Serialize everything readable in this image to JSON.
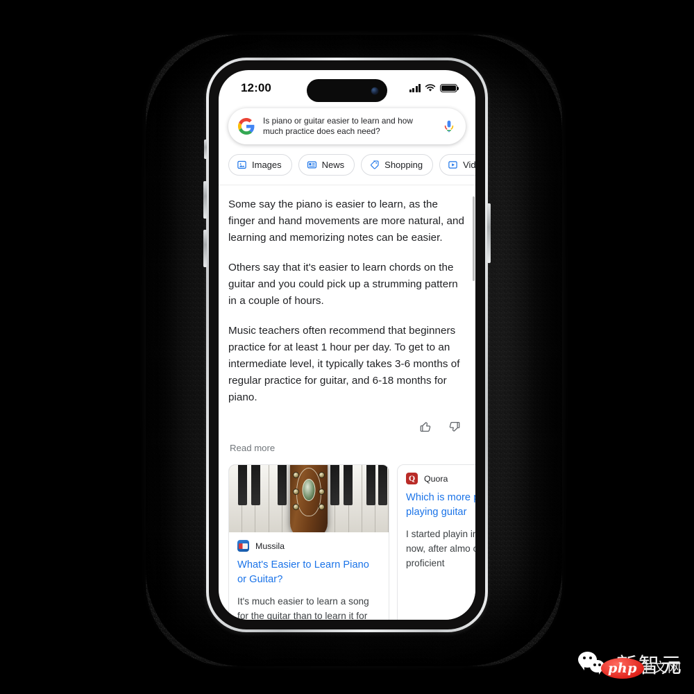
{
  "statusbar": {
    "time": "12:00",
    "signal_icon": "cellular-signal-icon",
    "wifi_icon": "wifi-icon",
    "battery_icon": "battery-full-icon"
  },
  "search": {
    "logo": "google-logo",
    "query": "Is piano or guitar easier to learn and how much practice does each need?",
    "mic_icon": "microphone-icon"
  },
  "chips": [
    {
      "label": "Images",
      "icon": "image-icon"
    },
    {
      "label": "News",
      "icon": "news-icon"
    },
    {
      "label": "Shopping",
      "icon": "tag-icon"
    },
    {
      "label": "Videos",
      "icon": "play-video-icon"
    }
  ],
  "answer": {
    "paragraphs": [
      "Some say the piano is easier to learn, as the finger and hand movements are more natural, and learning and memorizing notes can be easier.",
      "Others say that it's easier to learn chords on the guitar and you could pick up a strumming pattern in a couple of hours.",
      "Music teachers often recommend that beginners practice for at least 1 hour per day. To get to an intermediate level, it typically takes 3-6 months of regular practice for guitar, and 6-18 months for piano."
    ],
    "thumbs_up_icon": "thumbs-up-icon",
    "thumbs_down_icon": "thumbs-down-icon",
    "read_more": "Read more"
  },
  "cards": [
    {
      "source": "Mussila",
      "favicon": "mussila-favicon",
      "title": "What's Easier to Learn Piano or Guitar?",
      "snippet": "It's much easier to learn a song for the guitar than to learn it for",
      "thumbnail": "piano-keys-and-guitar-headstock-photo"
    },
    {
      "source": "Quora",
      "favicon": "quora-favicon",
      "title": "Which is more playing piano playing guitar",
      "snippet": "I started playin instruments th now, after almo continue to d proficient"
    }
  ],
  "watermark": {
    "brand": "新智元",
    "sub": "中文网",
    "badge": "php",
    "wechat_icon": "wechat-logo"
  },
  "colors": {
    "google_blue": "#1a73e8",
    "quora_red": "#b92b27",
    "text": "#202124",
    "muted": "#70757a"
  }
}
